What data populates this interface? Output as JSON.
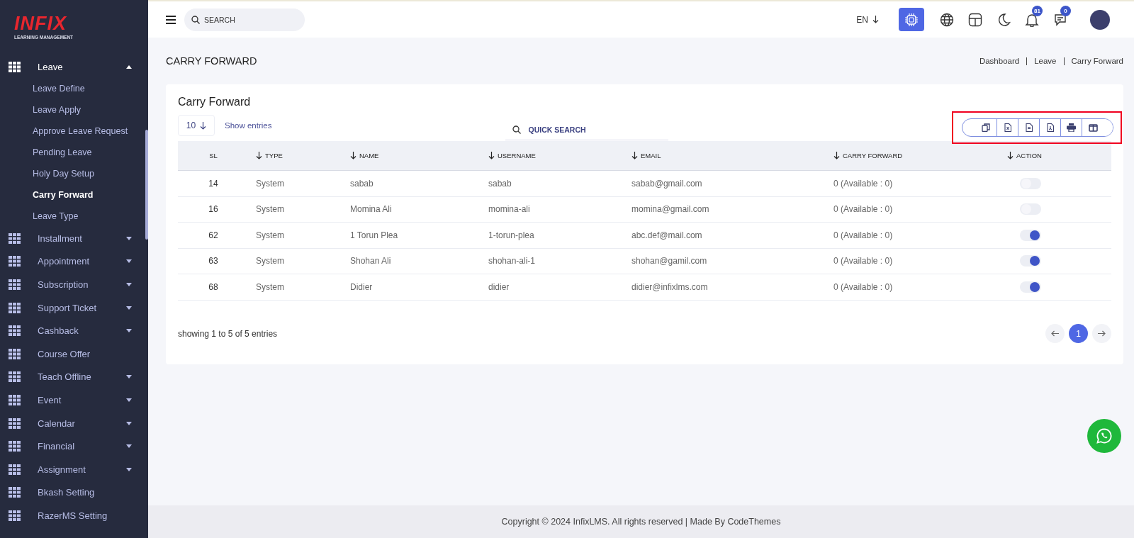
{
  "brand": {
    "logo": "INFIX",
    "tagline": "LEARNING MANAGEMENT"
  },
  "sidebar": {
    "items": [
      {
        "label": "Leave",
        "expanded": true,
        "has_caret": true,
        "children": [
          {
            "label": "Leave Define",
            "selected": false
          },
          {
            "label": "Leave Apply",
            "selected": false
          },
          {
            "label": "Approve Leave Request",
            "selected": false
          },
          {
            "label": "Pending Leave",
            "selected": false
          },
          {
            "label": "Holy Day Setup",
            "selected": false
          },
          {
            "label": "Carry Forward",
            "selected": true
          },
          {
            "label": "Leave Type",
            "selected": false
          }
        ]
      },
      {
        "label": "Installment",
        "expanded": false,
        "has_caret": true
      },
      {
        "label": "Appointment",
        "expanded": false,
        "has_caret": true
      },
      {
        "label": "Subscription",
        "expanded": false,
        "has_caret": true
      },
      {
        "label": "Support Ticket",
        "expanded": false,
        "has_caret": true
      },
      {
        "label": "Cashback",
        "expanded": false,
        "has_caret": true
      },
      {
        "label": "Course Offer",
        "expanded": false,
        "has_caret": false
      },
      {
        "label": "Teach Offline",
        "expanded": false,
        "has_caret": true
      },
      {
        "label": "Event",
        "expanded": false,
        "has_caret": true
      },
      {
        "label": "Calendar",
        "expanded": false,
        "has_caret": true
      },
      {
        "label": "Financial",
        "expanded": false,
        "has_caret": true
      },
      {
        "label": "Assignment",
        "expanded": false,
        "has_caret": true
      },
      {
        "label": "Bkash Setting",
        "expanded": false,
        "has_caret": false
      },
      {
        "label": "RazerMS Setting",
        "expanded": false,
        "has_caret": false
      }
    ]
  },
  "topbar": {
    "search": {
      "placeholder": "SEARCH"
    },
    "language": "EN",
    "notifications": "81",
    "messages": "0"
  },
  "page": {
    "title": "CARRY FORWARD",
    "breadcrumb": [
      "Dashboard",
      "Leave",
      "Carry Forward"
    ]
  },
  "card": {
    "title": "Carry Forward",
    "page_size": "10",
    "show_entries": "Show entries",
    "quick_search": {
      "placeholder": "QUICK SEARCH"
    },
    "export_buttons": {
      "highlighted": true,
      "buttons": [
        {
          "kind": "copy"
        },
        {
          "kind": "excel"
        },
        {
          "kind": "csv"
        },
        {
          "kind": "pdf"
        },
        {
          "kind": "print"
        },
        {
          "kind": "columns"
        }
      ]
    },
    "table": {
      "columns": [
        {
          "label": "SL",
          "sortable": false
        },
        {
          "label": "TYPE",
          "sortable": true
        },
        {
          "label": "NAME",
          "sortable": true
        },
        {
          "label": "USERNAME",
          "sortable": true
        },
        {
          "label": "EMAIL",
          "sortable": true
        },
        {
          "label": "CARRY FORWARD",
          "sortable": true
        },
        {
          "label": "ACTION",
          "sortable": true
        }
      ],
      "rows": [
        {
          "sl": "14",
          "type": "System",
          "name": "sabab",
          "username": "sabab",
          "email": "sabab@gmail.com",
          "carry_forward": "0 (Available : 0)",
          "on": false
        },
        {
          "sl": "16",
          "type": "System",
          "name": "Momina Ali",
          "username": "momina-ali",
          "email": "momina@gmail.com",
          "carry_forward": "0 (Available : 0)",
          "on": false
        },
        {
          "sl": "62",
          "type": "System",
          "name": "1 Torun Plea",
          "username": "1-torun-plea",
          "email": "abc.def@mail.com",
          "carry_forward": "0 (Available : 0)",
          "on": true
        },
        {
          "sl": "63",
          "type": "System",
          "name": "Shohan Ali",
          "username": "shohan-ali-1",
          "email": "shohan@gamil.com",
          "carry_forward": "0 (Available : 0)",
          "on": true
        },
        {
          "sl": "68",
          "type": "System",
          "name": "Didier",
          "username": "didier",
          "email": "didier@infixlms.com",
          "carry_forward": "0 (Available : 0)",
          "on": true
        }
      ]
    },
    "summary": "showing 1 to 5 of 5 entries",
    "pagination": {
      "pages": [
        {
          "label": "1",
          "selected": true
        }
      ]
    }
  },
  "footer": "Copyright © 2024 InfixLMS. All rights reserved | Made By CodeThemes"
}
